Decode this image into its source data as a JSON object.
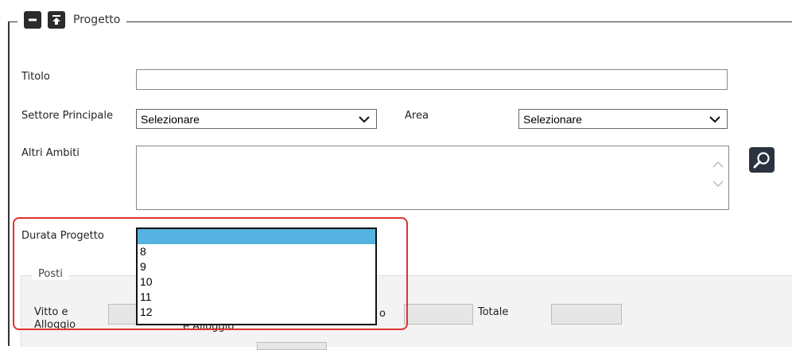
{
  "fieldset": {
    "title": "Progetto"
  },
  "fields": {
    "titolo_label": "Titolo",
    "settore_label": "Settore Principale",
    "settore_value": "Selezionare",
    "area_label": "Area",
    "area_value": "Selezionare",
    "altri_label": "Altri Ambiti",
    "durata_label": "Durata Progetto"
  },
  "durata_options": [
    "",
    "8",
    "9",
    "10",
    "11",
    "12"
  ],
  "posti": {
    "legend": "Posti",
    "vitto_label_1": "Vitto e",
    "vitto_label_2": "Alloggio",
    "partial_label_2": "e Alloggio",
    "partial_o": "o",
    "totale_label": "Totale"
  }
}
